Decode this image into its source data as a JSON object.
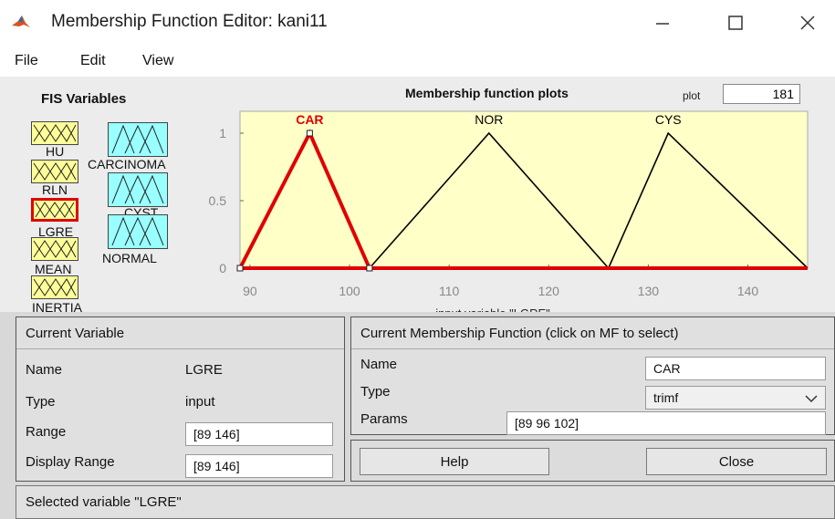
{
  "window": {
    "title": "Membership Function Editor: kani11"
  },
  "menu": {
    "items": [
      "File",
      "Edit",
      "View"
    ]
  },
  "fis": {
    "title": "FIS Variables",
    "inputs": [
      "HU",
      "RLN",
      "LGRE",
      "MEAN",
      "INERTIA"
    ],
    "outputs": [
      "CARCINOMA",
      "CYST",
      "NORMAL"
    ],
    "selected": "LGRE"
  },
  "plot": {
    "title": "Membership function plots",
    "points_label": "plot",
    "points_value": "181",
    "xlabel": "input variable \"LGRE\""
  },
  "chart_data": {
    "type": "line",
    "xlim": [
      89,
      146
    ],
    "ylim": [
      0,
      1
    ],
    "xticks": [
      90,
      100,
      110,
      120,
      130,
      140
    ],
    "yticks": [
      0,
      0.5,
      1
    ],
    "series": [
      {
        "name": "CAR",
        "mf": "trimf",
        "params": [
          89,
          96,
          102
        ],
        "selected": true,
        "color": "#e00000"
      },
      {
        "name": "NOR",
        "mf": "trimf",
        "params": [
          102,
          114,
          126
        ],
        "selected": false,
        "color": "#000000"
      },
      {
        "name": "CYS",
        "mf": "trimf",
        "params": [
          126,
          132,
          146
        ],
        "selected": false,
        "color": "#000000"
      }
    ],
    "background": "#ffffc8"
  },
  "current_variable": {
    "title": "Current Variable",
    "name_label": "Name",
    "name_value": "LGRE",
    "type_label": "Type",
    "type_value": "input",
    "range_label": "Range",
    "range_value": "[89 146]",
    "display_range_label": "Display Range",
    "display_range_value": "[89 146]"
  },
  "current_mf": {
    "title": "Current Membership Function (click on MF to select)",
    "name_label": "Name",
    "name_value": "CAR",
    "type_label": "Type",
    "type_value": "trimf",
    "params_label": "Params",
    "params_value": "[89 96 102]"
  },
  "buttons": {
    "help": "Help",
    "close": "Close"
  },
  "status": "Selected variable \"LGRE\""
}
